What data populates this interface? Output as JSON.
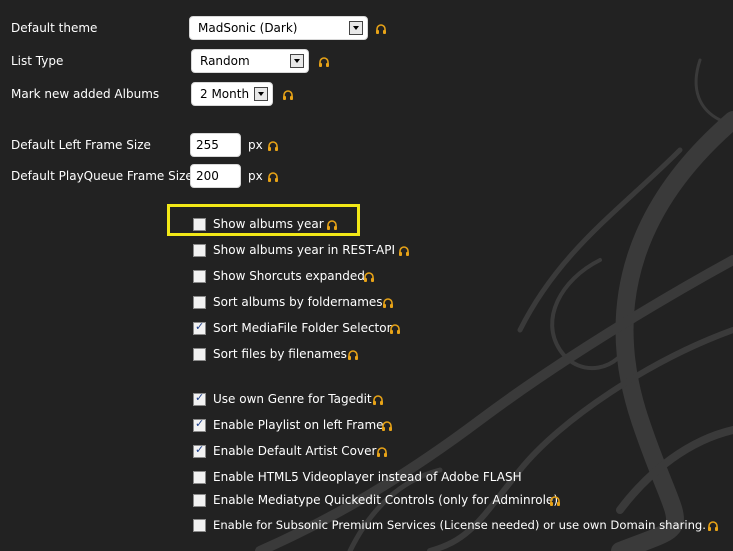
{
  "settings": {
    "default_theme": {
      "label": "Default theme",
      "value": "MadSonic (Dark)"
    },
    "list_type": {
      "label": "List Type",
      "value": "Random"
    },
    "mark_new_albums": {
      "label": "Mark new added Albums",
      "value": "2 Month"
    },
    "left_frame": {
      "label": "Default Left Frame Size",
      "value": "255",
      "unit": "px"
    },
    "playqueue_frame": {
      "label": "Default PlayQueue Frame Size",
      "value": "200",
      "unit": "px"
    }
  },
  "checkboxes": [
    {
      "label": "Show albums year",
      "checked": false,
      "headphone": true
    },
    {
      "label": "Show albums year in REST-API",
      "checked": false,
      "headphone": true
    },
    {
      "label": "Show Shorcuts expanded",
      "checked": false,
      "headphone": true
    },
    {
      "label": "Sort albums by foldernames",
      "checked": false,
      "headphone": true
    },
    {
      "label": "Sort MediaFile Folder Selector",
      "checked": true,
      "headphone": true
    },
    {
      "label": "Sort files by filenames",
      "checked": false,
      "headphone": true
    },
    {
      "label": "Use own Genre for Tagedit",
      "checked": true,
      "headphone": true
    },
    {
      "label": "Enable Playlist on left Frame",
      "checked": true,
      "headphone": true
    },
    {
      "label": "Enable Default Artist Cover",
      "checked": true,
      "headphone": true
    },
    {
      "label": "Enable HTML5 Videoplayer instead of Adobe FLASH",
      "checked": false,
      "headphone": false
    },
    {
      "label": "Enable Mediatype Quickedit Controls (only for Adminrole)",
      "checked": false,
      "headphone": true
    },
    {
      "label": "Enable for Subsonic Premium Services (License needed) or use own Domain sharing.",
      "checked": false,
      "headphone": true
    }
  ],
  "colors": {
    "background": "#222222",
    "highlight": "#f2e817",
    "headphone_icon": "#e8a317"
  },
  "icons": {
    "help": "headphone-icon"
  }
}
